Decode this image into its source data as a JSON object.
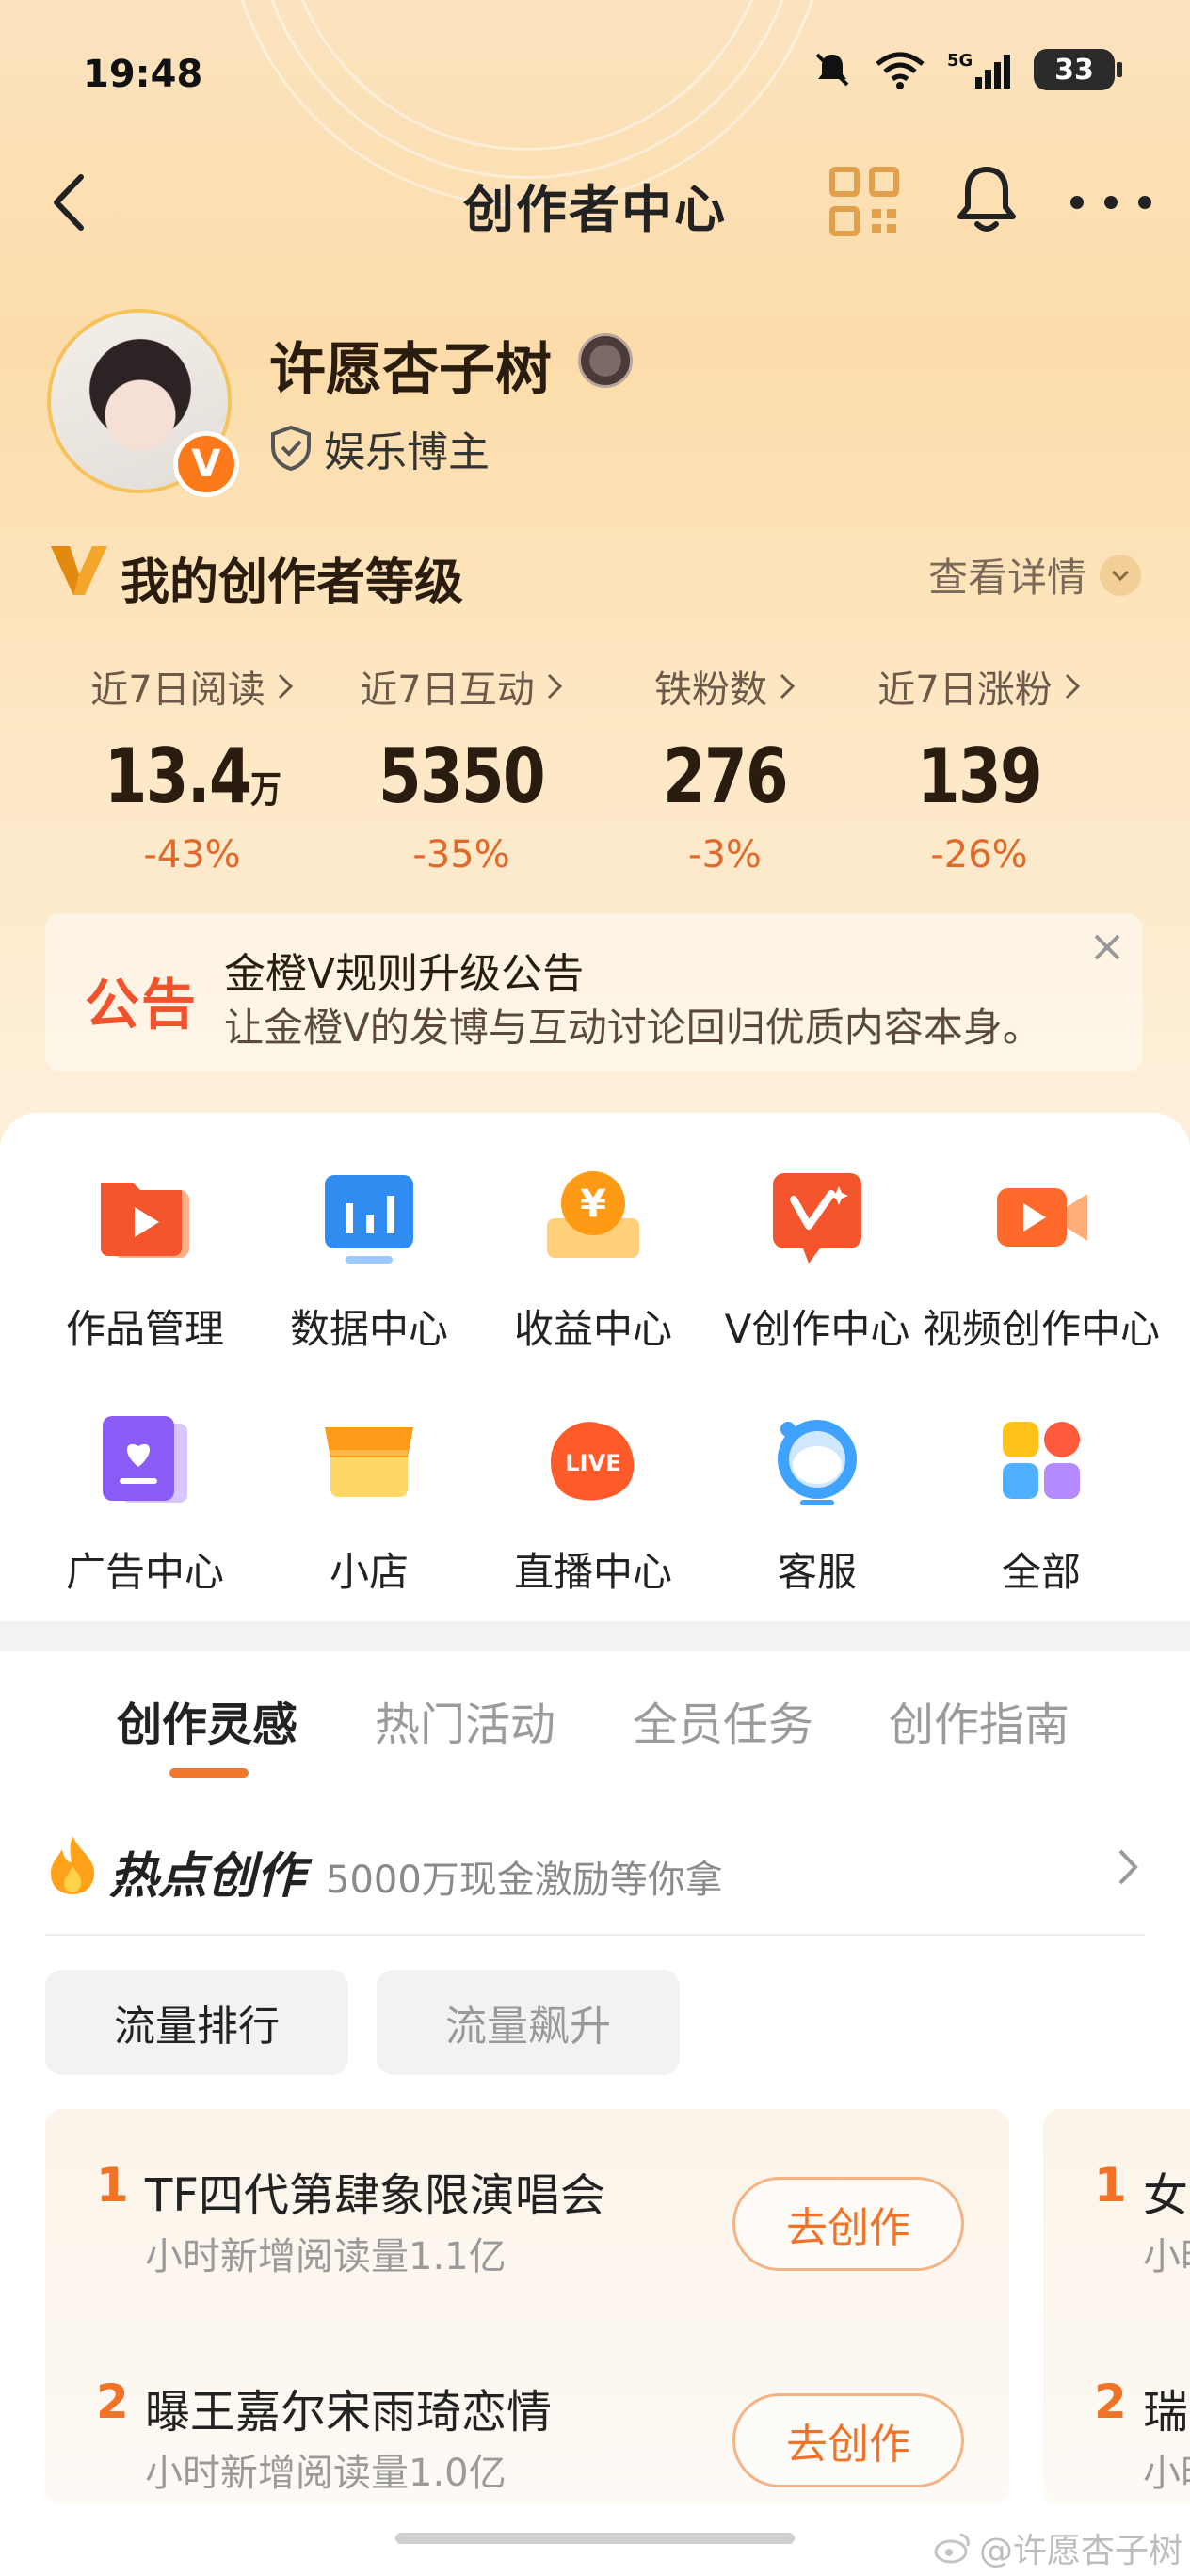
{
  "status_bar": {
    "time": "19:48",
    "battery": "33",
    "network": "5G"
  },
  "nav": {
    "title": "创作者中心"
  },
  "profile": {
    "name": "许愿杏子树",
    "badge": "V",
    "role": "娱乐博主"
  },
  "level": {
    "title": "我的创作者等级",
    "detail": "查看详情"
  },
  "stats": [
    {
      "label": "近7日阅读",
      "value": "13.4",
      "unit": "万",
      "change": "-43%"
    },
    {
      "label": "近7日互动",
      "value": "5350",
      "unit": "",
      "change": "-35%"
    },
    {
      "label": "铁粉数",
      "value": "276",
      "unit": "",
      "change": "-3%"
    },
    {
      "label": "近7日涨粉",
      "value": "139",
      "unit": "",
      "change": "-26%"
    }
  ],
  "notice": {
    "tag": "公告",
    "title": "金橙V规则升级公告",
    "text": "让金橙V的发博与互动讨论回归优质内容本身。"
  },
  "grid": [
    {
      "label": "作品管理",
      "icon": "works-folder-icon"
    },
    {
      "label": "数据中心",
      "icon": "data-chart-icon"
    },
    {
      "label": "收益中心",
      "icon": "yen-coin-icon"
    },
    {
      "label": "V创作中心",
      "icon": "v-creation-icon"
    },
    {
      "label": "视频创作中心",
      "icon": "video-camera-icon"
    },
    {
      "label": "广告中心",
      "icon": "ad-heart-icon"
    },
    {
      "label": "小店",
      "icon": "shop-icon"
    },
    {
      "label": "直播中心",
      "icon": "live-icon"
    },
    {
      "label": "客服",
      "icon": "customer-service-icon"
    },
    {
      "label": "全部",
      "icon": "all-apps-icon"
    }
  ],
  "tabs": [
    "创作灵感",
    "热门活动",
    "全员任务",
    "创作指南"
  ],
  "hot": {
    "title": "热点创作",
    "subtitle": "5000万现金激励等你拿"
  },
  "chips": [
    "流量排行",
    "流量飙升"
  ],
  "list": [
    {
      "rank": "1",
      "title": "TF四代第肆象限演唱会",
      "sub": "小时新增阅读量1.1亿",
      "button": "去创作"
    },
    {
      "rank": "2",
      "title": "曝王嘉尔宋雨琦恋情",
      "sub": "小时新增阅读量1.0亿",
      "button": "去创作"
    }
  ],
  "list2": [
    {
      "rank": "1",
      "title": "女",
      "sub": "小时"
    },
    {
      "rank": "2",
      "title": "瑞",
      "sub": "小时"
    }
  ],
  "watermark": "@许愿杏子树"
}
